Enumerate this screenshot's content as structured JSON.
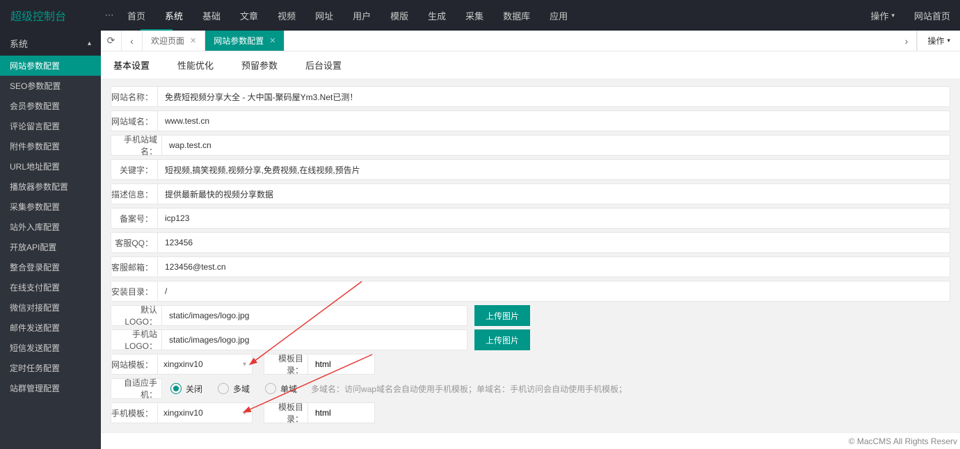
{
  "brand": "超级控制台",
  "topnav": [
    "首页",
    "系统",
    "基础",
    "文章",
    "视频",
    "网址",
    "用户",
    "模版",
    "生成",
    "采集",
    "数据库",
    "应用"
  ],
  "topnav_active_index": 1,
  "top_right": {
    "ops": "操作",
    "home": "网站首页"
  },
  "sidebar": {
    "head": "系统",
    "items": [
      "网站参数配置",
      "SEO参数配置",
      "会员参数配置",
      "评论留言配置",
      "附件参数配置",
      "URL地址配置",
      "播放器参数配置",
      "采集参数配置",
      "站外入库配置",
      "开放API配置",
      "整合登录配置",
      "在线支付配置",
      "微信对接配置",
      "邮件发送配置",
      "短信发送配置",
      "定时任务配置",
      "站群管理配置"
    ],
    "active_index": 0
  },
  "tabs": {
    "items": [
      "欢迎页面",
      "网站参数配置"
    ],
    "active_index": 1,
    "ops": "操作"
  },
  "subnav": {
    "items": [
      "基本设置",
      "性能优化",
      "预留参数",
      "后台设置"
    ],
    "active_index": 0
  },
  "form": {
    "site_name": {
      "label": "网站名称：",
      "value": "免费短视频分享大全 - 大中国-聚码屋Ym3.Net已测！"
    },
    "site_domain": {
      "label": "网站域名：",
      "value": "www.test.cn"
    },
    "wap_domain": {
      "label": "手机站域名：",
      "value": "wap.test.cn"
    },
    "keywords": {
      "label": "关键字：",
      "value": "短视频,搞笑视频,视频分享,免费视频,在线视频,预告片"
    },
    "description": {
      "label": "描述信息：",
      "value": "提供最新最快的视频分享数据"
    },
    "icp": {
      "label": "备案号：",
      "value": "icp123"
    },
    "qq": {
      "label": "客服QQ：",
      "value": "123456"
    },
    "email": {
      "label": "客服邮箱：",
      "value": "123456@test.cn"
    },
    "install_dir": {
      "label": "安装目录：",
      "value": "/"
    },
    "logo": {
      "label": "默认LOGO：",
      "value": "static/images/logo.jpg",
      "btn": "上传图片"
    },
    "wap_logo": {
      "label": "手机站LOGO：",
      "value": "static/images/logo.jpg",
      "btn": "上传图片"
    },
    "site_tpl": {
      "label": "网站模板：",
      "value": "xingxinv10",
      "dir_label": "模板目录：",
      "dir_value": "html"
    },
    "adaptive": {
      "label": "自适应手机：",
      "options": [
        "关闭",
        "多域",
        "单域"
      ],
      "selected_index": 0,
      "hint": "多域名：访问wap域名会自动使用手机模板；单域名：手机访问会自动使用手机模板；"
    },
    "wap_tpl": {
      "label": "手机模板：",
      "value": "xingxinv10",
      "dir_label": "模板目录：",
      "dir_value": "html"
    }
  },
  "footer": "© MacCMS All Rights Reserv"
}
